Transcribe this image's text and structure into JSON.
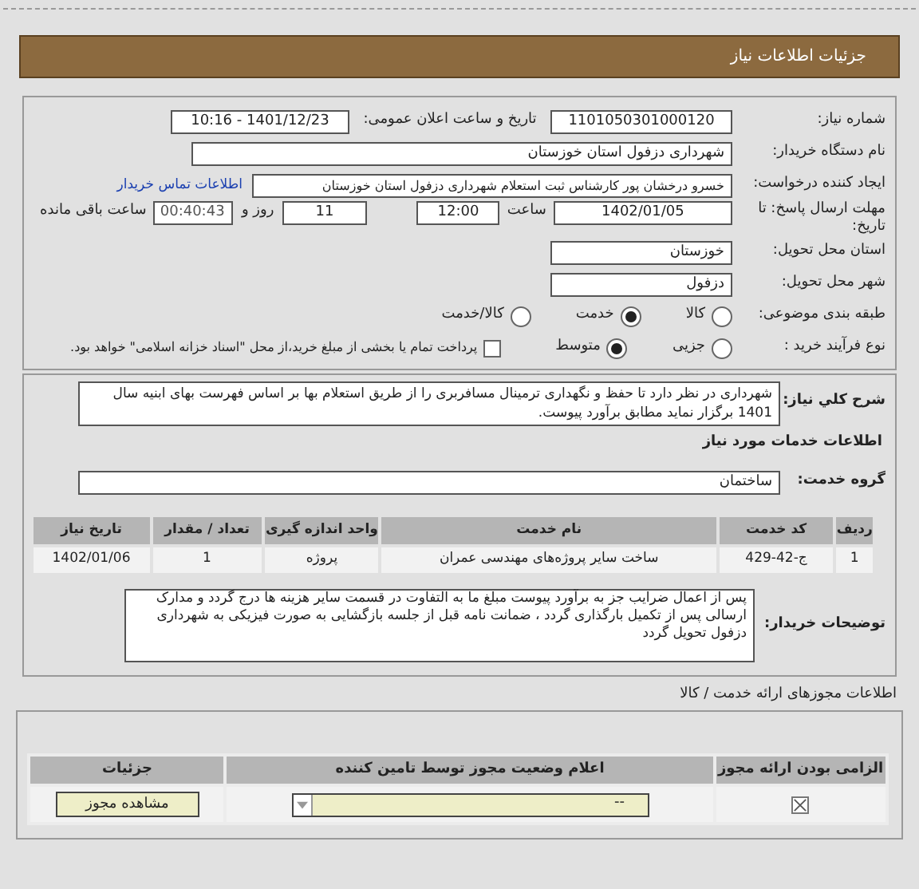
{
  "header": {
    "title": "جزئیات اطلاعات نیاز"
  },
  "need_number": {
    "label": "شماره نیاز:",
    "value": "1101050301000120"
  },
  "announce": {
    "label": "تاریخ و ساعت اعلان عمومی:",
    "value": "1401/12/23 - 10:16"
  },
  "buyer": {
    "label": "نام دستگاه خریدار:",
    "value": "شهرداری دزفول استان خوزستان"
  },
  "creator": {
    "label": "ایجاد کننده درخواست:",
    "value": "خسرو درخشان پور کارشناس ثبت استعلام شهرداری دزفول استان خوزستان",
    "link": "اطلاعات تماس خریدار"
  },
  "deadline": {
    "label_line1": "مهلت ارسال پاسخ: تا",
    "label_line2": "تاریخ:",
    "date": "1402/01/05",
    "time_label": "ساعت",
    "time": "12:00",
    "days": "11",
    "days_label": "روز و",
    "remaining": "00:40:43",
    "remaining_label": "ساعت باقی مانده"
  },
  "province": {
    "label": "استان محل تحویل:",
    "value": "خوزستان"
  },
  "city": {
    "label": "شهر محل تحویل:",
    "value": "دزفول"
  },
  "category": {
    "label": "طبقه بندی موضوعی:",
    "options": [
      {
        "label": "کالا",
        "selected": false
      },
      {
        "label": "خدمت",
        "selected": true
      },
      {
        "label": "کالا/خدمت",
        "selected": false
      }
    ]
  },
  "process": {
    "label": "نوع فرآیند خرید :",
    "options": [
      {
        "label": "جزیی",
        "selected": false
      },
      {
        "label": "متوسط",
        "selected": true
      }
    ],
    "payment": {
      "label": "پرداخت تمام یا بخشی از مبلغ خرید،از محل \"اسناد خزانه اسلامی\" خواهد بود.",
      "checked": false
    }
  },
  "description": {
    "label": "شرح کلي نياز:",
    "value": "شهرداری در نظر دارد تا حفظ و نگهداری ترمینال مسافربری را از طریق استعلام بها بر اساس فهرست بهای ابنیه سال 1401 برگزار نماید مطابق برآورد پیوست."
  },
  "services_title": "اطلاعات خدمات مورد نیاز",
  "group": {
    "label": "گروه خدمت:",
    "value": "ساختمان"
  },
  "table": {
    "columns": [
      "ردیف",
      "کد خدمت",
      "نام خدمت",
      "واحد اندازه گیری",
      "تعداد / مقدار",
      "تاریخ نیاز"
    ],
    "rows": [
      [
        "1",
        "ج-42-429",
        "ساخت سایر پروژه‌های مهندسی عمران",
        "پروژه",
        "1",
        "1402/01/06"
      ]
    ]
  },
  "notes": {
    "label": "توضیحات خریدار:",
    "value": "پس از اعمال ضرایب جز به برآورد پیوست مبلغ ما به التفاوت در قسمت سایر هزینه ها درج گردد و مدارک ارسالی پس از تکمیل بارگذاری گردد ، ضمانت نامه قبل از جلسه بازگشایی به صورت فیزیکی به شهرداری دزفول تحویل گردد"
  },
  "permits_title": "اطلاعات مجوزهای ارائه خدمت / کالا",
  "permits": {
    "columns": [
      "الزامی بودن ارائه مجوز",
      "اعلام وضعیت مجوز توسط تامین کننده",
      "جزئیات"
    ],
    "rows": [
      {
        "required": true,
        "status": "--",
        "button": "مشاهده مجوز"
      }
    ]
  }
}
